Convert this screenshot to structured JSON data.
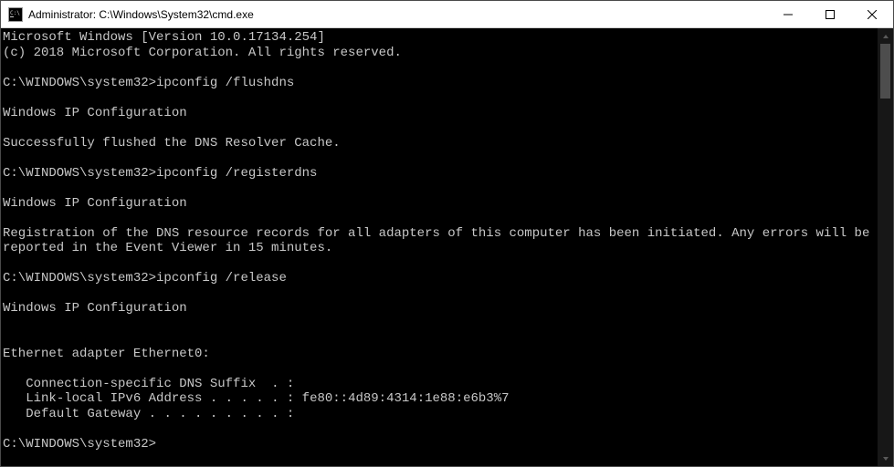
{
  "titlebar": {
    "title": "Administrator: C:\\Windows\\System32\\cmd.exe"
  },
  "terminal": {
    "lines": [
      "Microsoft Windows [Version 10.0.17134.254]",
      "(c) 2018 Microsoft Corporation. All rights reserved.",
      "",
      "C:\\WINDOWS\\system32>ipconfig /flushdns",
      "",
      "Windows IP Configuration",
      "",
      "Successfully flushed the DNS Resolver Cache.",
      "",
      "C:\\WINDOWS\\system32>ipconfig /registerdns",
      "",
      "Windows IP Configuration",
      "",
      "Registration of the DNS resource records for all adapters of this computer has been initiated. Any errors will be reported in the Event Viewer in 15 minutes.",
      "",
      "C:\\WINDOWS\\system32>ipconfig /release",
      "",
      "Windows IP Configuration",
      "",
      "",
      "Ethernet adapter Ethernet0:",
      "",
      "   Connection-specific DNS Suffix  . :",
      "   Link-local IPv6 Address . . . . . : fe80::4d89:4314:1e88:e6b3%7",
      "   Default Gateway . . . . . . . . . :",
      "",
      "C:\\WINDOWS\\system32>"
    ]
  }
}
